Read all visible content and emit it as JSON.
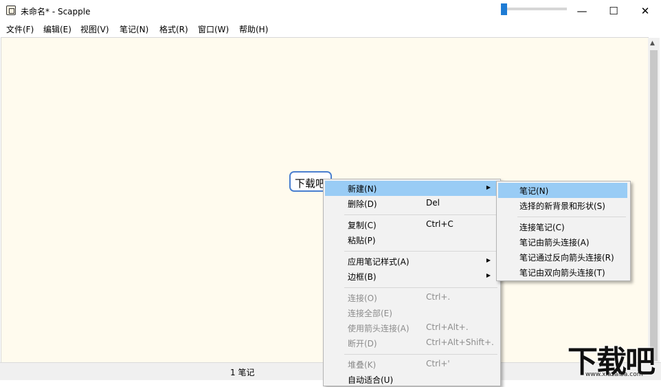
{
  "window": {
    "title": "未命名* - Scapple",
    "controls": [
      "—",
      "☐",
      "✕"
    ]
  },
  "menubar": [
    "文件(F)",
    "编辑(E)",
    "视图(V)",
    "笔记(N)",
    "格式(R)",
    "窗口(W)",
    "帮助(H)"
  ],
  "canvas": {
    "background": "#fffbee",
    "note_text": "下载吧"
  },
  "context_menu": {
    "items": [
      {
        "label": "新建(N)",
        "shortcut": "",
        "submenu": true,
        "highlighted": true,
        "disabled": false
      },
      {
        "label": "删除(D)",
        "shortcut": "Del",
        "submenu": false,
        "highlighted": false,
        "disabled": false
      },
      {
        "label": "复制(C)",
        "shortcut": "Ctrl+C",
        "submenu": false,
        "highlighted": false,
        "disabled": false
      },
      {
        "label": "粘贴(P)",
        "shortcut": "",
        "submenu": false,
        "highlighted": false,
        "disabled": false
      },
      {
        "label": "应用笔记样式(A)",
        "shortcut": "",
        "submenu": true,
        "highlighted": false,
        "disabled": false
      },
      {
        "label": "边框(B)",
        "shortcut": "",
        "submenu": true,
        "highlighted": false,
        "disabled": false
      },
      {
        "label": "连接(O)",
        "shortcut": "Ctrl+.",
        "submenu": false,
        "highlighted": false,
        "disabled": true
      },
      {
        "label": "连接全部(E)",
        "shortcut": "",
        "submenu": false,
        "highlighted": false,
        "disabled": true
      },
      {
        "label": "使用箭头连接(A)",
        "shortcut": "Ctrl+Alt+.",
        "submenu": false,
        "highlighted": false,
        "disabled": true
      },
      {
        "label": "断开(D)",
        "shortcut": "Ctrl+Alt+Shift+.",
        "submenu": false,
        "highlighted": false,
        "disabled": true
      },
      {
        "label": "堆叠(K)",
        "shortcut": "Ctrl+'",
        "submenu": false,
        "highlighted": false,
        "disabled": true
      },
      {
        "label": "自动适合(U)",
        "shortcut": "",
        "submenu": false,
        "highlighted": false,
        "disabled": false
      }
    ]
  },
  "submenu": {
    "items": [
      {
        "label": "笔记(N)",
        "highlighted": true
      },
      {
        "label": "选择的新背景和形状(S)",
        "highlighted": false
      },
      {
        "label": "连接笔记(C)",
        "highlighted": false
      },
      {
        "label": "笔记由箭头连接(A)",
        "highlighted": false
      },
      {
        "label": "笔记通过反向箭头连接(R)",
        "highlighted": false
      },
      {
        "label": "笔记由双向箭头连接(T)",
        "highlighted": false
      }
    ]
  },
  "status": {
    "count_text": "1 笔记"
  },
  "watermark": {
    "main": "下载吧",
    "url": "www.xiazaiba.com"
  },
  "colors": {
    "highlight": "#99ccf5",
    "note_border": "#4a7fcf",
    "zoom_accent": "#1e7bd4"
  }
}
